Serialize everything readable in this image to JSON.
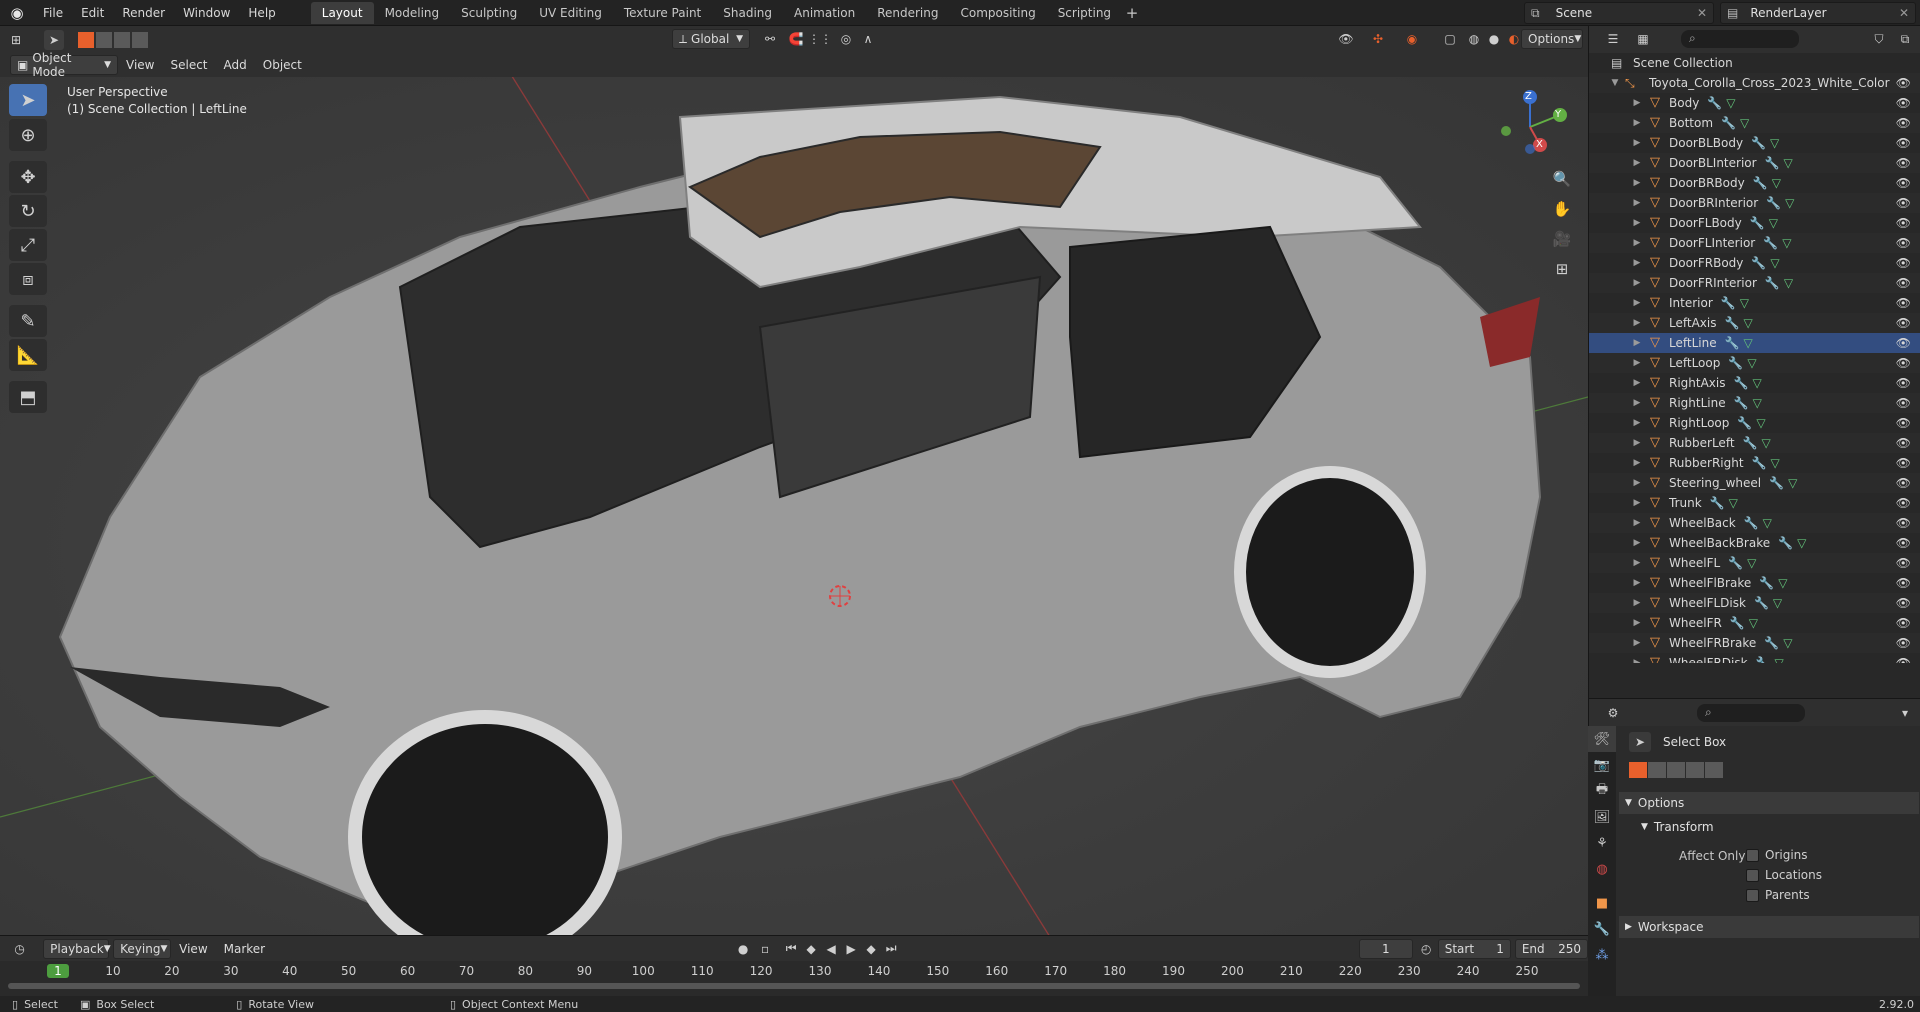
{
  "topbar": {
    "menus": [
      "File",
      "Edit",
      "Render",
      "Window",
      "Help"
    ],
    "workspaces": [
      "Layout",
      "Modeling",
      "Sculpting",
      "UV Editing",
      "Texture Paint",
      "Shading",
      "Animation",
      "Rendering",
      "Compositing",
      "Scripting"
    ],
    "active_workspace": "Layout",
    "add_tab": "+",
    "scene": "Scene",
    "view_layer": "RenderLayer"
  },
  "viewport": {
    "mode": "Object Mode",
    "menus": [
      "View",
      "Select",
      "Add",
      "Object"
    ],
    "orientation": "Global",
    "options_label": "Options",
    "perspective_label": "User Perspective",
    "collection_label": "(1) Scene Collection | LeftLine",
    "gizmo": {
      "x": "X",
      "y": "Y",
      "z": "Z"
    }
  },
  "outliner": {
    "root": "Scene Collection",
    "collection": "Toyota_Corolla_Cross_2023_White_Color",
    "items": [
      "Body",
      "Bottom",
      "DoorBLBody",
      "DoorBLInterior",
      "DoorBRBody",
      "DoorBRInterior",
      "DoorFLBody",
      "DoorFLInterior",
      "DoorFRBody",
      "DoorFRInterior",
      "Interior",
      "LeftAxis",
      "LeftLine",
      "LeftLoop",
      "RightAxis",
      "RightLine",
      "RightLoop",
      "RubberLeft",
      "RubberRight",
      "Steering_wheel",
      "Trunk",
      "WheelBack",
      "WheelBackBrake",
      "WheelFL",
      "WheelFlBrake",
      "WheelFLDisk",
      "WheelFR",
      "WheelFRBrake",
      "WheelFRDisk"
    ],
    "selected": "LeftLine"
  },
  "properties": {
    "tool_name": "Select Box",
    "options_panel": "Options",
    "transform_panel": "Transform",
    "affect_only": "Affect Only",
    "checkboxes": [
      "Origins",
      "Locations",
      "Parents"
    ],
    "workspace_panel": "Workspace"
  },
  "timeline": {
    "menus": [
      "Playback",
      "Keying",
      "View",
      "Marker"
    ],
    "current_frame": "1",
    "start_label": "Start",
    "start": "1",
    "end_label": "End",
    "end": "250",
    "ticks": [
      "1",
      "10",
      "20",
      "30",
      "40",
      "50",
      "60",
      "70",
      "80",
      "90",
      "100",
      "110",
      "120",
      "130",
      "140",
      "150",
      "160",
      "170",
      "180",
      "190",
      "200",
      "210",
      "220",
      "230",
      "240",
      "250"
    ]
  },
  "statusbar": {
    "select": "Select",
    "box_select": "Box Select",
    "rotate_view": "Rotate View",
    "context_menu": "Object Context Menu",
    "version": "2.92.0"
  }
}
